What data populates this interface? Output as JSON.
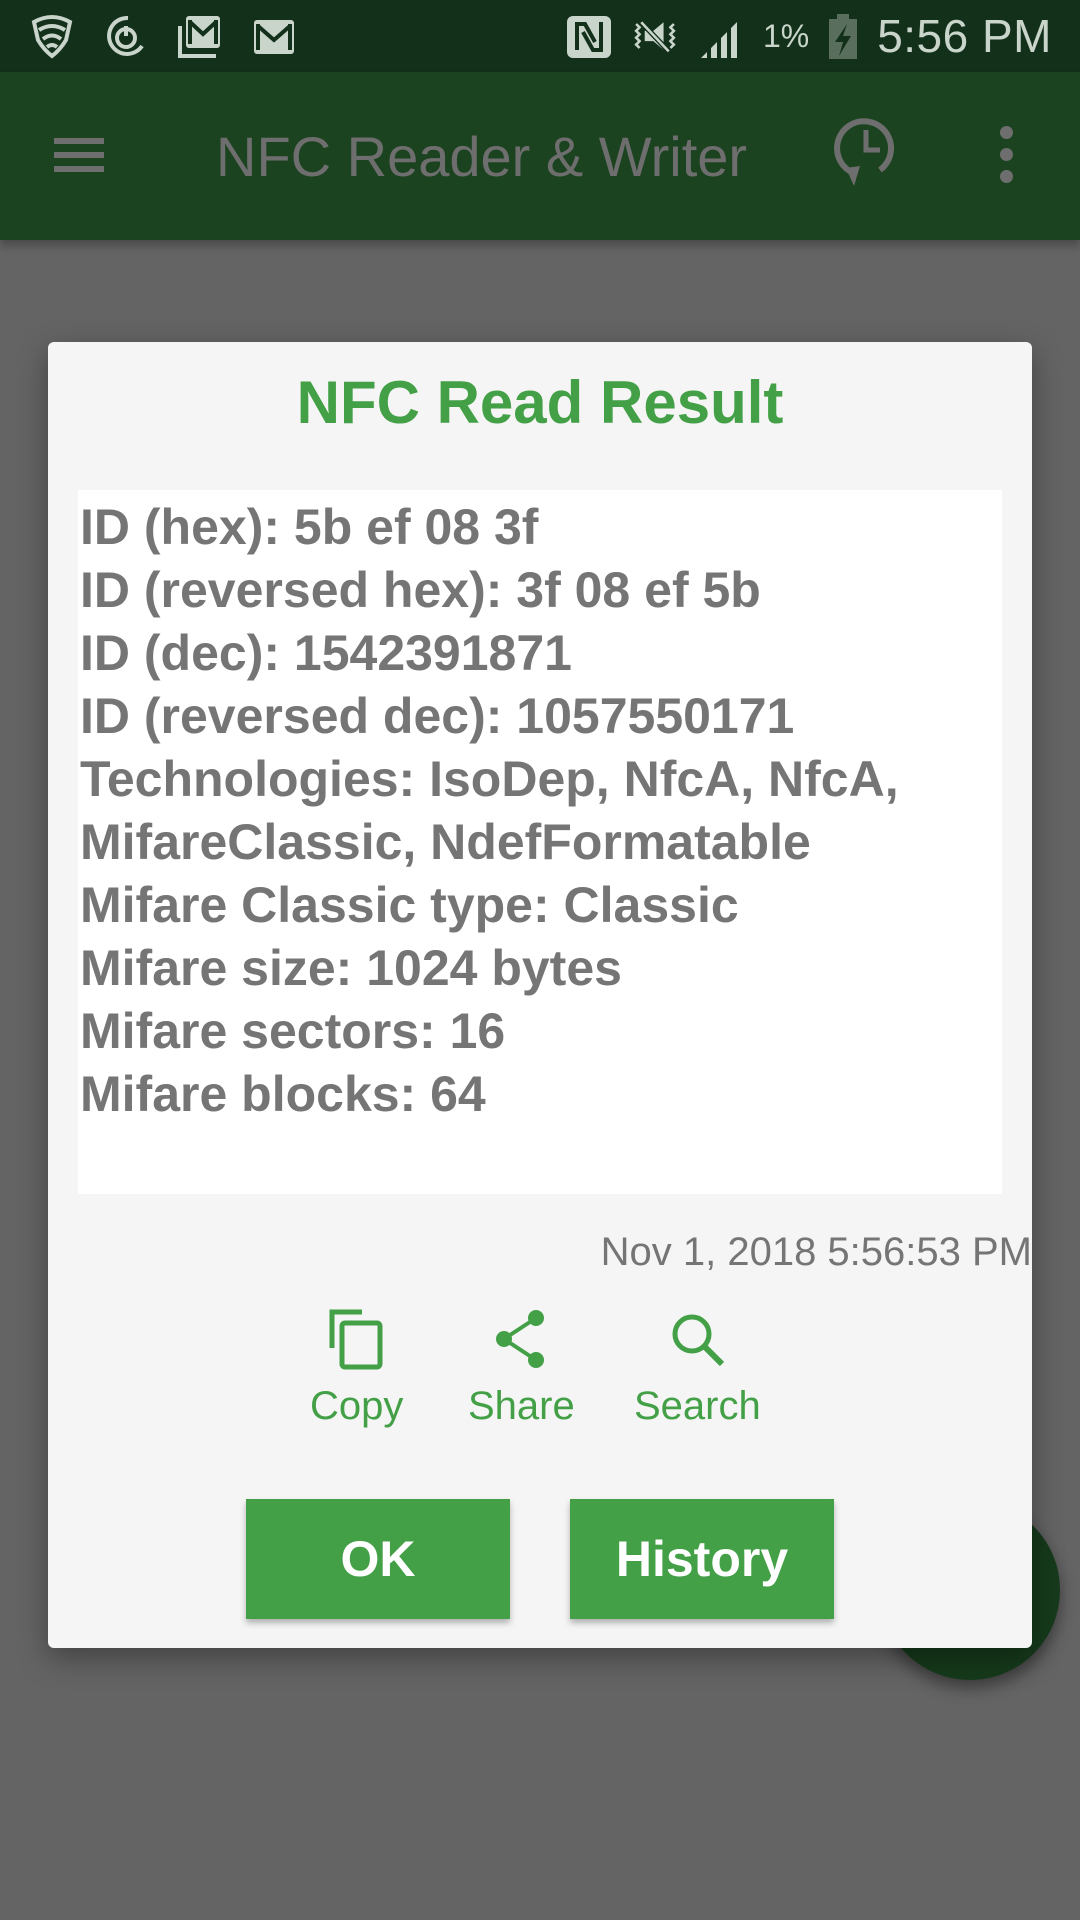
{
  "status_bar": {
    "left_icons": [
      "lookout-shield-icon",
      "sync-power-icon",
      "gmail-multiple-icon",
      "gmail-icon"
    ],
    "right_icons": [
      "nfc-icon",
      "vibrate-mute-icon",
      "signal-icon",
      "battery-charging-icon"
    ],
    "battery_percent": "1%",
    "time": "5:56 PM"
  },
  "app_bar": {
    "title": "NFC Reader & Writer",
    "menu_icon": "hamburger-menu-icon",
    "history_icon": "history-clock-icon",
    "overflow_icon": "more-vert-icon"
  },
  "dialog": {
    "title": "NFC Read Result",
    "lines": [
      "ID (hex): 5b ef 08 3f",
      "ID (reversed hex): 3f 08 ef 5b",
      "ID (dec): 1542391871",
      "ID (reversed dec): 1057550171",
      "Technologies: IsoDep, NfcA, NfcA,",
      "MifareClassic, NdefFormatable",
      "Mifare Classic type: Classic",
      "Mifare size: 1024 bytes",
      "Mifare sectors: 16",
      "Mifare blocks: 64"
    ],
    "timestamp": "Nov 1, 2018 5:56:53 PM",
    "actions": {
      "copy": "Copy",
      "share": "Share",
      "search": "Search"
    },
    "buttons": {
      "ok": "OK",
      "history": "History"
    }
  },
  "colors": {
    "accent": "#43a047",
    "app_bar": "#1c4320",
    "status_bar": "#12301a",
    "scrim": "#646464"
  }
}
